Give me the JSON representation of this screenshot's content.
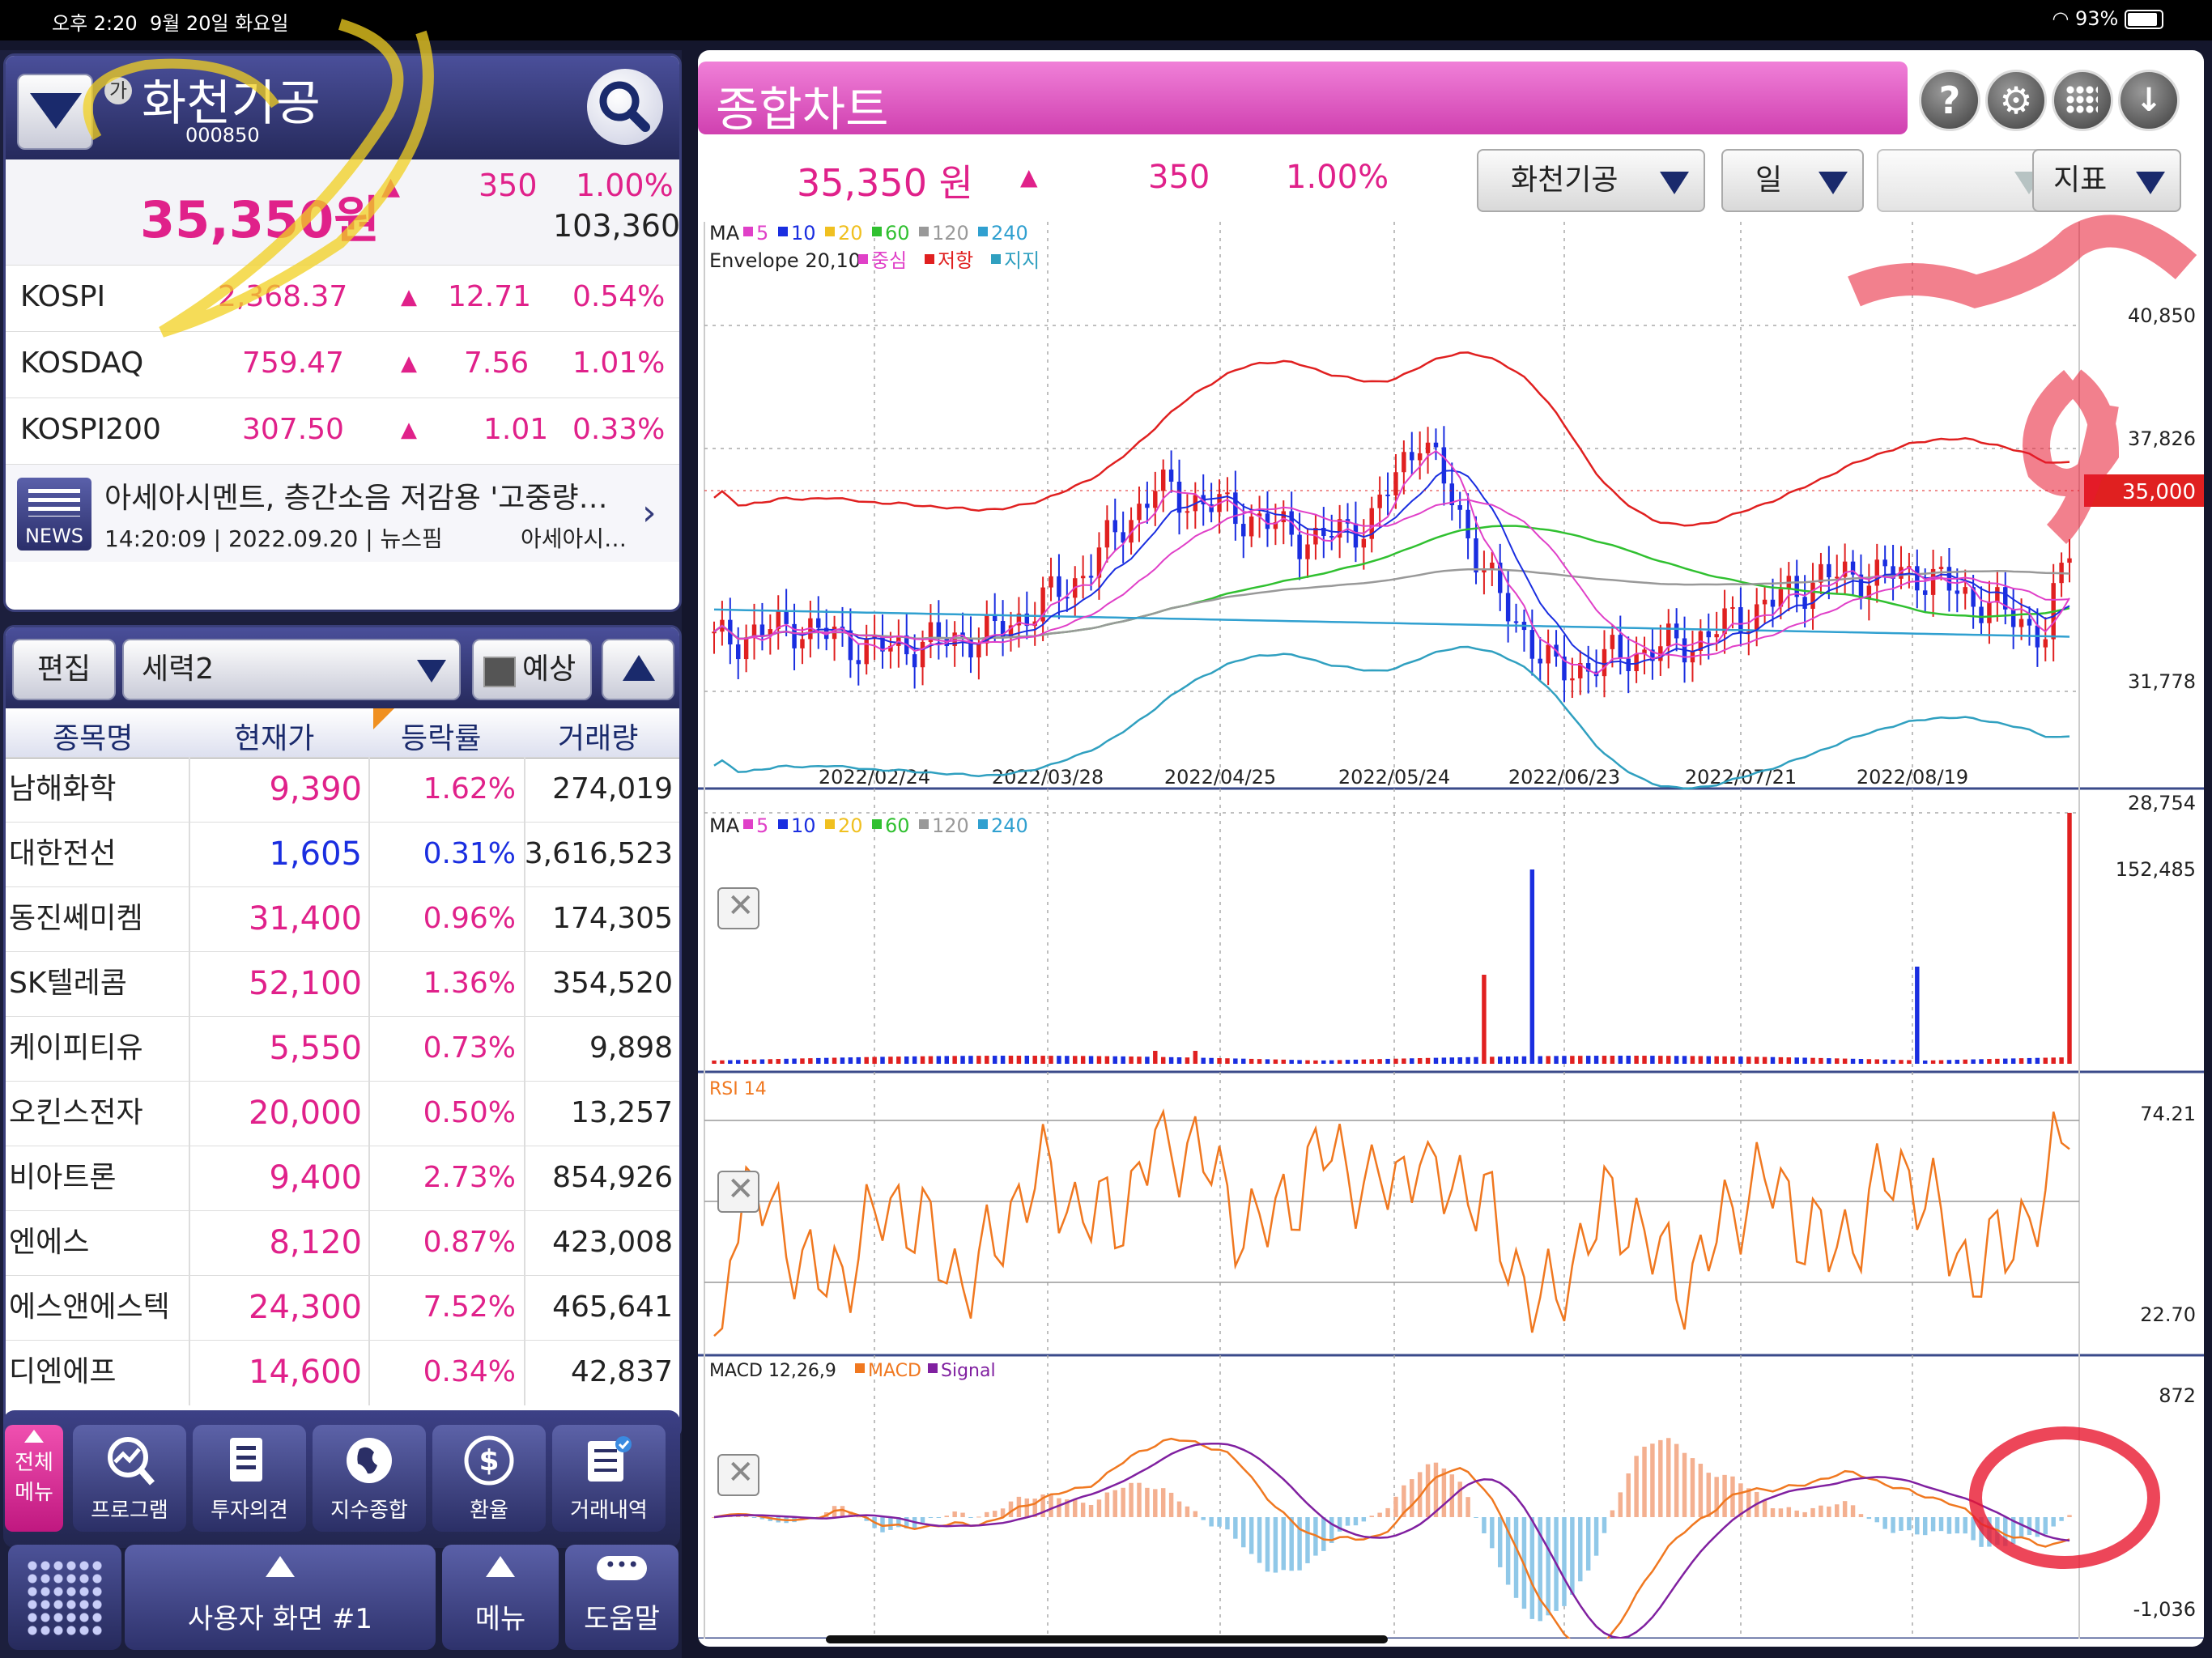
{
  "status": {
    "time": "오후 2:20",
    "date": "9월 20일 화요일",
    "battery": "93%"
  },
  "stock": {
    "name": "화천기공",
    "code": "000850",
    "price": "35,350원",
    "change": "350",
    "rate": "1.00%",
    "volume": "103,360"
  },
  "indices": [
    {
      "name": "KOSPI",
      "value": "2,368.37",
      "change": "12.71",
      "rate": "0.54%"
    },
    {
      "name": "KOSDAQ",
      "value": "759.47",
      "change": "7.56",
      "rate": "1.01%"
    },
    {
      "name": "KOSPI200",
      "value": "307.50",
      "change": "1.01",
      "rate": "0.33%"
    }
  ],
  "news": {
    "badge": "NEWS",
    "title": "아세아시멘트, 층간소음 저감용 '고중량…",
    "meta": "14:20:09 | 2022.09.20 | 뉴스핌",
    "source": "아세아시…"
  },
  "list": {
    "edit_label": "편집",
    "group": "세력2",
    "predict_label": "예상",
    "headers": [
      "종목명",
      "현재가",
      "등락률",
      "거래량"
    ],
    "rows": [
      {
        "name": "남해화학",
        "price": "9,390",
        "rate": "1.62%",
        "volume": "274,019",
        "color": "pink"
      },
      {
        "name": "대한전선",
        "price": "1,605",
        "rate": "0.31%",
        "volume": "3,616,523",
        "color": "blue"
      },
      {
        "name": "동진쎄미켐",
        "price": "31,400",
        "rate": "0.96%",
        "volume": "174,305",
        "color": "pink"
      },
      {
        "name": "SK텔레콤",
        "price": "52,100",
        "rate": "1.36%",
        "volume": "354,520",
        "color": "pink"
      },
      {
        "name": "케이피티유",
        "price": "5,550",
        "rate": "0.73%",
        "volume": "9,898",
        "color": "pink"
      },
      {
        "name": "오킨스전자",
        "price": "20,000",
        "rate": "0.50%",
        "volume": "13,257",
        "color": "pink"
      },
      {
        "name": "비아트론",
        "price": "9,400",
        "rate": "2.73%",
        "volume": "854,926",
        "color": "pink"
      },
      {
        "name": "엔에스",
        "price": "8,120",
        "rate": "0.87%",
        "volume": "423,008",
        "color": "pink"
      },
      {
        "name": "에스앤에스텍",
        "price": "24,300",
        "rate": "7.52%",
        "volume": "465,641",
        "color": "pink"
      },
      {
        "name": "디엔에프",
        "price": "14,600",
        "rate": "0.34%",
        "volume": "42,837",
        "color": "pink"
      }
    ]
  },
  "toolbar": {
    "all_menu": [
      "전체",
      "메뉴"
    ],
    "items": [
      "프로그램",
      "투자의견",
      "지수종합",
      "환율",
      "거래내역"
    ]
  },
  "bottom": {
    "user_screen": "사용자 화면 #1",
    "menu": "메뉴",
    "help": "도움말"
  },
  "chart_panel": {
    "title": "종합차트",
    "price": "35,350 원",
    "change": "350",
    "rate": "1.00%",
    "stock_select": "화천기공",
    "period_select": "일",
    "empty_select": "",
    "indicator_select": "지표",
    "current_label": "35,000"
  },
  "chart_data": {
    "type": "candlestick",
    "dates": [
      "2022/02/24",
      "2022/03/28",
      "2022/04/25",
      "2022/05/24",
      "2022/06/23",
      "2022/07/21",
      "2022/08/19"
    ],
    "price_axis": [
      "40,850",
      "37,826",
      "31,778",
      "28,754"
    ],
    "ma_legend": {
      "label": "MA",
      "periods": [
        "5",
        "10",
        "20",
        "60",
        "120",
        "240"
      ]
    },
    "envelope_legend": {
      "label": "Envelope 20,10",
      "items": [
        "중심",
        "저항",
        "지지"
      ]
    },
    "volume_axis": [
      "152,485"
    ],
    "rsi": {
      "label": "RSI 14",
      "axis": [
        "74.21",
        "22.70"
      ]
    },
    "macd": {
      "label": "MACD 12,26,9",
      "items": [
        "MACD",
        "Signal"
      ],
      "axis": [
        "872",
        "-1,036"
      ]
    },
    "colors": {
      "ma5": "#e040c8",
      "ma10": "#1a2ee0",
      "ma20": "#f0c020",
      "ma60": "#30c030",
      "ma120": "#999999",
      "ma240": "#30a0d0",
      "up": "#e02020",
      "down": "#1a2ee0",
      "rsi": "#f07820",
      "macd": "#f07820",
      "signal": "#8020a0",
      "envelope_mid": "#e040c8",
      "envelope_upper": "#e02020",
      "envelope_lower": "#30a0c0"
    }
  }
}
